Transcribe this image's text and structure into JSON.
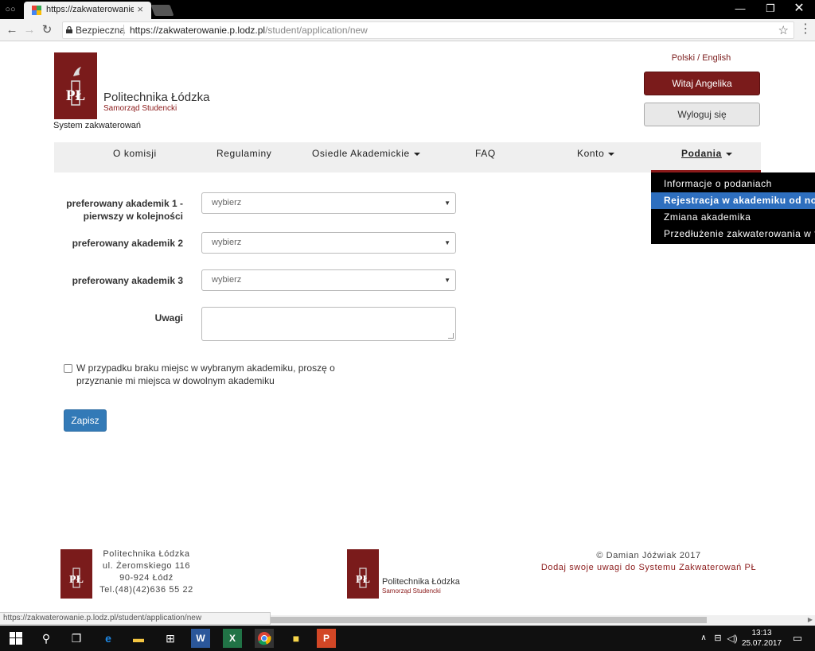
{
  "browser": {
    "tab_title": "https://zakwaterowanie.p",
    "secure_label": "Bezpieczna",
    "url_main": "https://zakwaterowanie.p.lodz.pl",
    "url_path": "/student/application/new",
    "status_url": "https://zakwaterowanie.p.lodz.pl/student/application/new"
  },
  "header": {
    "logo_monogram": "PŁ",
    "logo_line1": "Politechnika Łódzka",
    "logo_line2": "Samorząd Studencki",
    "system_label": "System zakwaterowań",
    "lang": "Polski / English",
    "welcome_button": "Witaj Angelika",
    "logout_button": "Wyloguj się"
  },
  "nav": {
    "items": [
      "O komisji",
      "Regulaminy",
      "Osiedle Akademickie",
      "FAQ",
      "Konto",
      "Podania"
    ],
    "active": "Podania"
  },
  "dropdown": {
    "items": [
      "Informacje o podaniach",
      "Rejestracja w akademiku od nowa",
      "Zmiana akademika",
      "Przedłużenie zakwaterowania w tym samym"
    ],
    "highlighted_index": 1
  },
  "form": {
    "pref1_label_line1": "preferowany akademik 1 -",
    "pref1_label_line2": "pierwszy w kolejności",
    "pref2_label": "preferowany akademik 2",
    "pref3_label": "preferowany akademik 3",
    "select_value": "wybierz",
    "notes_label": "Uwagi",
    "notes_value": "",
    "checkbox_checked": false,
    "checkbox_label": "W przypadku braku miejsc w wybranym akademiku, proszę o przyznanie mi miejsca w dowolnym akademiku",
    "save_button": "Zapisz"
  },
  "footer": {
    "addr_line1": "Politechnika Łódzka",
    "addr_line2": "ul. Żeromskiego 116",
    "addr_line3": "90-924 Łódź",
    "addr_line4": "Tel.(48)(42)636 55 22",
    "brand_line1": "Politechnika Łódzka",
    "brand_line2": "Samorząd Studencki",
    "copyright": "© Damian Jóźwiak 2017",
    "feedback_link": "Dodaj swoje uwagi do Systemu Zakwaterowań PŁ"
  },
  "taskbar": {
    "time": "13:13",
    "date": "25.07.2017"
  },
  "colors": {
    "brand": "#7a1b1b",
    "primary": "#337ab7",
    "dropdown_highlight": "#2e6fbf"
  }
}
